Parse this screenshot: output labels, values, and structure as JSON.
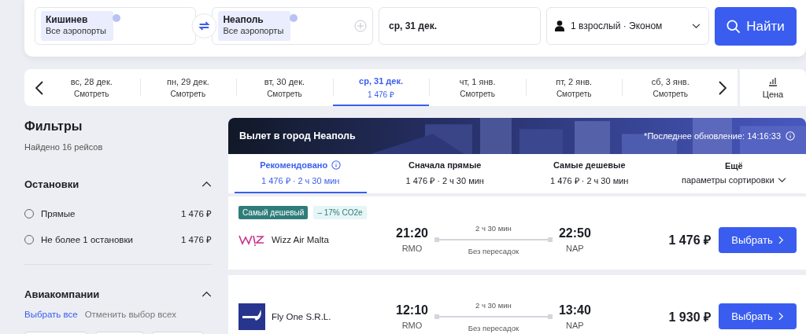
{
  "search": {
    "origin": {
      "city": "Кишинев",
      "airports": "Все аэропорты"
    },
    "destination": {
      "city": "Неаполь",
      "airports": "Все аэропорты"
    },
    "date": "ср, 31 дек.",
    "passengers": "1 взрослый · Эконом",
    "button": "Найти"
  },
  "dates": [
    {
      "day": "вс, 28 дек.",
      "sub": "Смотреть",
      "selected": false
    },
    {
      "day": "пн, 29 дек.",
      "sub": "Смотреть",
      "selected": false
    },
    {
      "day": "вт, 30 дек.",
      "sub": "Смотреть",
      "selected": false
    },
    {
      "day": "ср, 31 дек.",
      "sub": "1 476 ₽",
      "selected": true
    },
    {
      "day": "чт, 1 янв.",
      "sub": "Смотреть",
      "selected": false
    },
    {
      "day": "пт, 2 янв.",
      "sub": "Смотреть",
      "selected": false
    },
    {
      "day": "сб, 3 янв.",
      "sub": "Смотреть",
      "selected": false
    }
  ],
  "price_chart_button": "Цена",
  "filters": {
    "title": "Фильтры",
    "found": "Найдено 16 рейсов",
    "stops": {
      "title": "Остановки",
      "expanded": true,
      "options": [
        {
          "label": "Прямые",
          "price": "1 476 ₽",
          "selected": false
        },
        {
          "label": "Не более 1 остановки",
          "price": "1 476 ₽",
          "selected": false
        }
      ]
    },
    "airlines": {
      "title": "Авиакомпании",
      "expanded": true,
      "select_all": "Выбрать все",
      "deselect_all": "Отменить выбор всех"
    }
  },
  "results": {
    "title": "Вылет в город Неаполь",
    "updated": "*Последнее обновление: 14:16:33",
    "sort_tabs": [
      {
        "title": "Рекомендовано",
        "sub": "1 476 ₽ · 2 ч 30 мин",
        "info": true,
        "selected": true
      },
      {
        "title": "Сначала прямые",
        "sub": "1 476 ₽ · 2 ч 30 мин",
        "info": false,
        "selected": false
      },
      {
        "title": "Самые дешевые",
        "sub": "1 476 ₽ · 2 ч 30 мин",
        "info": false,
        "selected": false
      },
      {
        "title": "Ещё",
        "sub": "параметры сортировки",
        "info": false,
        "selected": false
      }
    ],
    "flights": [
      {
        "badges": [
          {
            "kind": "cheapest",
            "text": "Самый дешевый"
          },
          {
            "kind": "eco",
            "text": "– 17% CO2e"
          }
        ],
        "kind": "script",
        "airline": "Wizz Air Malta",
        "depart": "21:20",
        "from": "RMO",
        "duration": "2 ч 30 мин",
        "stops": "Без пересадок",
        "arrive": "22:50",
        "to": "NAP",
        "price": "1 476 ₽",
        "button": "Выбрать"
      },
      {
        "kind": "square",
        "airline": "Fly One S.R.L.",
        "depart": "12:10",
        "from": "RMO",
        "duration": "2 ч 30 мин",
        "stops": "Без пересадок",
        "arrive": "13:40",
        "to": "NAP",
        "price": "1 930 ₽",
        "button": "Выбрать"
      }
    ]
  }
}
